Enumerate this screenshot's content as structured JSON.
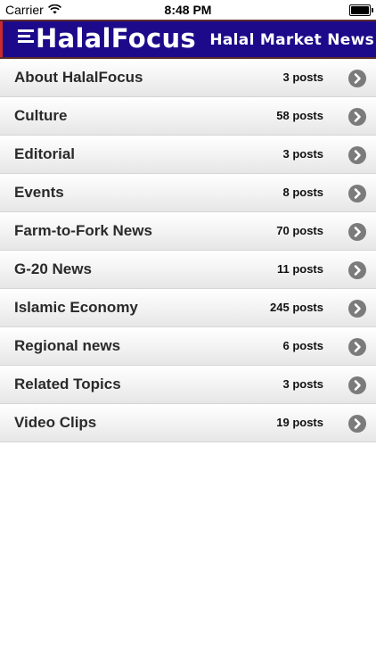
{
  "status_bar": {
    "carrier": "Carrier",
    "time": "8:48 PM",
    "wifi_icon": "wifi-icon",
    "battery_icon": "battery-icon",
    "battery_level": 1.0
  },
  "header": {
    "title": "HalalFocus",
    "tagline": "Halal Market News",
    "logo_icon": "menu-lines-logo-icon",
    "background": "#1c0a8a"
  },
  "categories": [
    {
      "title": "About HalalFocus",
      "count": "3 posts"
    },
    {
      "title": "Culture",
      "count": "58 posts"
    },
    {
      "title": "Editorial",
      "count": "3 posts"
    },
    {
      "title": "Events",
      "count": "8 posts"
    },
    {
      "title": "Farm-to-Fork News",
      "count": "70 posts"
    },
    {
      "title": "G-20 News",
      "count": "11 posts"
    },
    {
      "title": "Islamic Economy",
      "count": "245 posts"
    },
    {
      "title": "Regional news",
      "count": "6 posts"
    },
    {
      "title": "Related Topics",
      "count": "3 posts"
    },
    {
      "title": "Video Clips",
      "count": "19 posts"
    }
  ]
}
